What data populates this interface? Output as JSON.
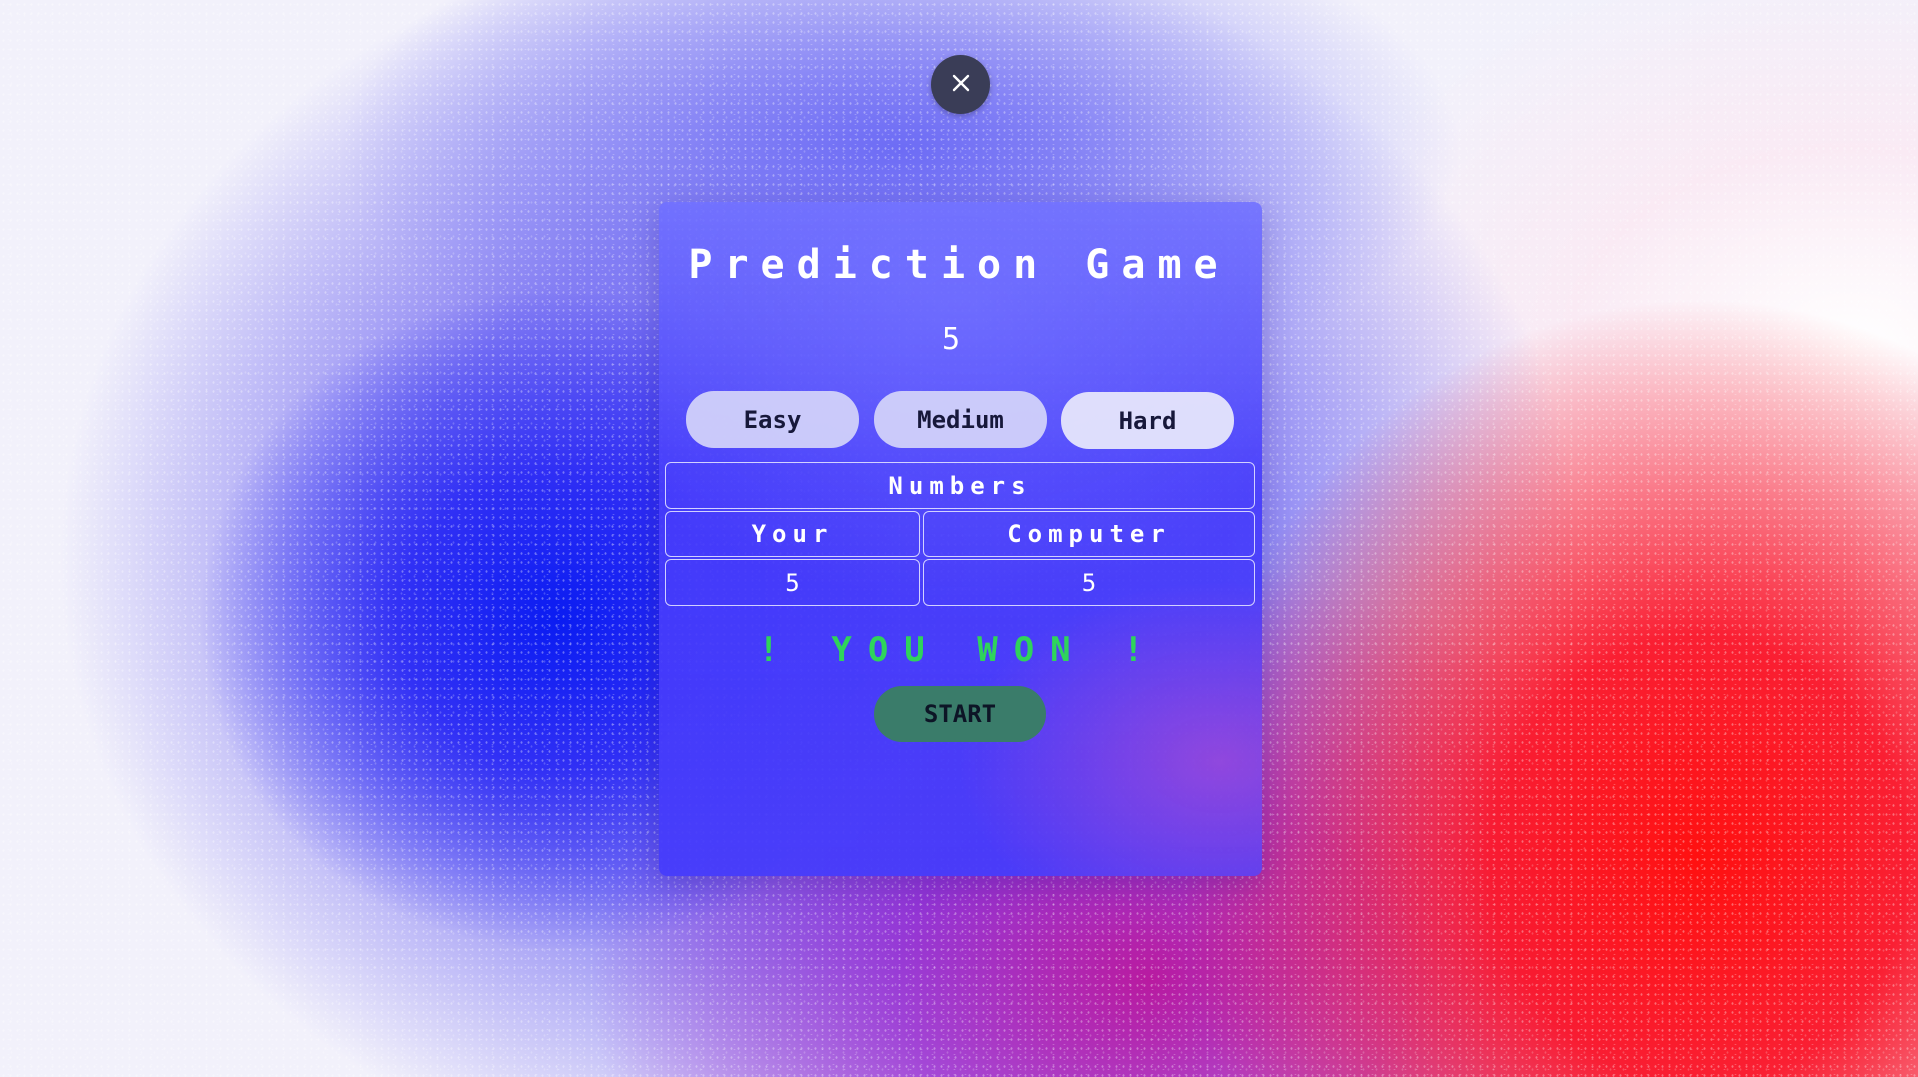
{
  "game": {
    "title": "Prediction Game",
    "target_number": "5",
    "close_icon": "close-icon",
    "modes": {
      "easy": "Easy",
      "medium": "Medium",
      "hard": "Hard"
    },
    "table": {
      "header": "Numbers",
      "your_label": "Your",
      "computer_label": "Computer",
      "your_value": "5",
      "computer_value": "5"
    },
    "result_text": "! YOU WON !",
    "start_label": "START"
  },
  "colors": {
    "result_green": "#2fd35b",
    "start_button": "#3a7c6a",
    "close_button": "#3a3d57"
  }
}
